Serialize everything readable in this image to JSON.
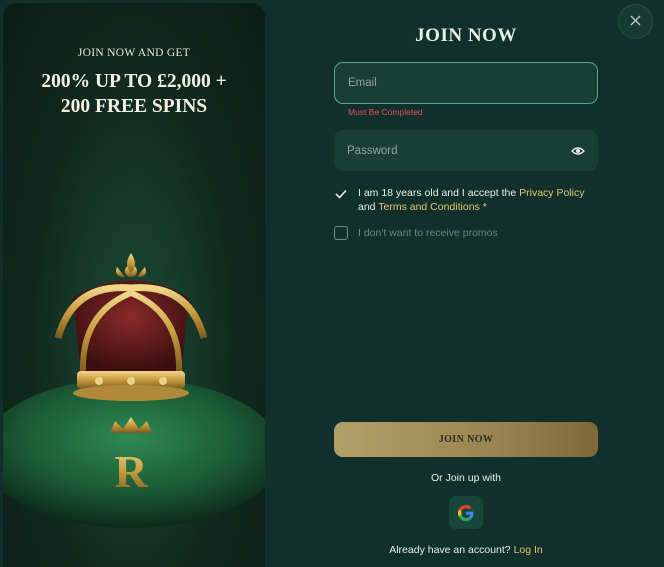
{
  "promo": {
    "subtitle": "JOIN NOW AND GET",
    "headline_line1": "200% UP TO £2,000 +",
    "headline_line2": "200 FREE SPINS",
    "logo_letter": "R"
  },
  "form": {
    "title": "JOIN NOW",
    "email_placeholder": "Email",
    "email_error": "Must Be Completed",
    "password_placeholder": "Password",
    "terms_prefix": "I am 18 years old and I accept the ",
    "privacy_link": "Privacy Policy",
    "terms_mid": "and ",
    "terms_link": "Terms and Conditions",
    "required_star": " *",
    "terms_checked": true,
    "promo_opt_out": "I don't want to receive promos",
    "promo_opt_out_checked": false,
    "join_button": "JOIN NOW",
    "or_join": "Or Join up with",
    "have_account": "Already have an account? ",
    "login_link": "Log In"
  },
  "colors": {
    "background": "#12302b",
    "accent_gold": "#e2c56f",
    "error": "#e0505a",
    "input_bg": "#183e36",
    "input_border_active": "#5aa497"
  },
  "icons": {
    "close": "close-icon",
    "password_toggle": "eye-icon",
    "checkbox": "checkmark-icon",
    "social": "google-icon"
  }
}
